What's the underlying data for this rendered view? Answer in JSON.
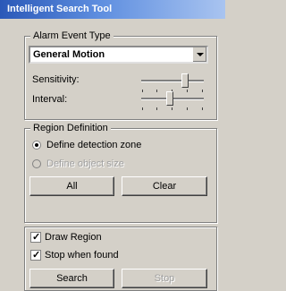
{
  "window": {
    "title": "Intelligent Search Tool"
  },
  "alarm_event": {
    "legend": "Alarm Event Type",
    "selected": "General Motion",
    "sensitivity_label": "Sensitivity:",
    "sensitivity_value": 0.72,
    "interval_label": "Interval:",
    "interval_value": 0.45
  },
  "region": {
    "legend": "Region Definition",
    "option_zone": "Define detection zone",
    "option_object": "Define object size",
    "all_label": "All",
    "clear_label": "Clear"
  },
  "options": {
    "draw_region_label": "Draw Region",
    "draw_region_checked": true,
    "stop_when_found_label": "Stop when found",
    "stop_when_found_checked": true
  },
  "actions": {
    "search_label": "Search",
    "stop_label": "Stop"
  }
}
